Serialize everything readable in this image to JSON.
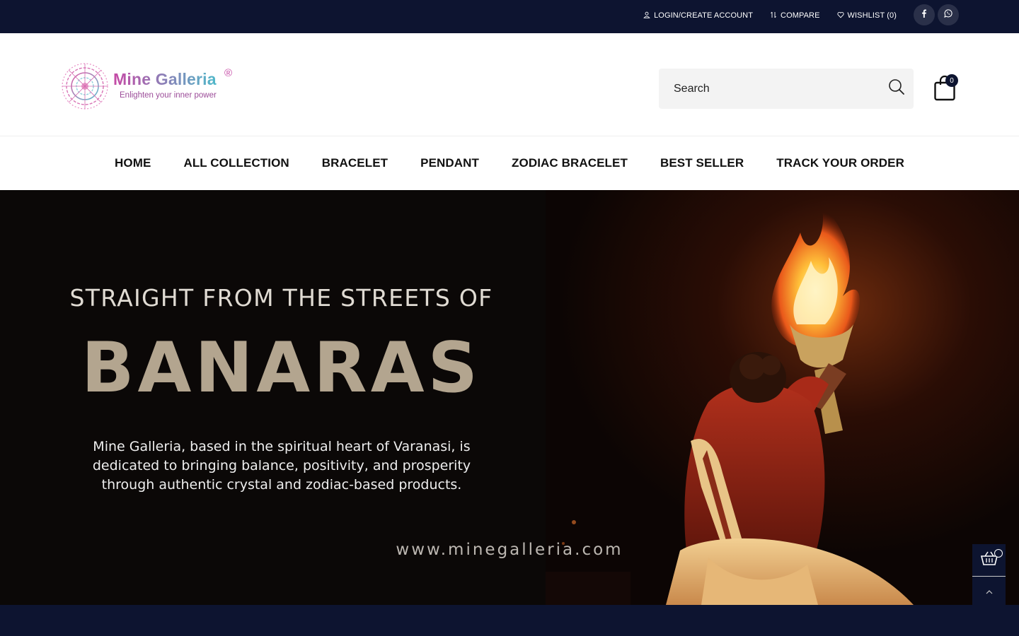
{
  "topbar": {
    "links": [
      {
        "label": "LOGIN/CREATE ACCOUNT",
        "icon": "user-icon"
      },
      {
        "label": "COMPARE",
        "icon": "compare-icon"
      },
      {
        "label": "WISHLIST (0)",
        "icon": "heart-icon"
      }
    ],
    "social": [
      {
        "icon": "facebook-icon"
      },
      {
        "icon": "whatsapp-icon"
      }
    ],
    "background": "#0d1430"
  },
  "header": {
    "logo": {
      "name": "Mine Galleria",
      "registered": "®",
      "tagline": "Enlighten your inner power"
    },
    "search": {
      "placeholder": "Search"
    },
    "cart": {
      "count": "0",
      "icon": "shopping-bag-icon"
    }
  },
  "nav": {
    "items": [
      "HOME",
      "ALL COLLECTION",
      "BRACELET",
      "PENDANT",
      "ZODIAC BRACELET",
      "BEST SELLER",
      "TRACK YOUR ORDER"
    ]
  },
  "hero": {
    "kicker": "STRAIGHT FROM THE STREETS OF",
    "title": "BANARAS",
    "description": "Mine Galleria, based in the spiritual heart of Varanasi, is dedicated to bringing balance, positivity, and prosperity through authentic crystal and zodiac-based products.",
    "url": "www.minegalleria.com"
  },
  "floating": {
    "cart_icon": "basket-icon",
    "top_icon": "chevron-up-icon"
  },
  "colors": {
    "navy": "#0d1430",
    "hero_title": "#b3a58f",
    "brand_pink": "#c64aa6",
    "brand_teal": "#4fb8c9"
  }
}
